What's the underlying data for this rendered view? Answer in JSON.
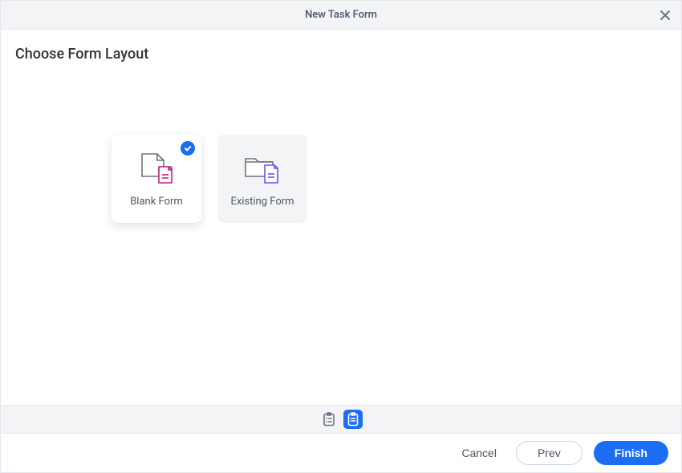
{
  "dialog": {
    "title": "New Task Form"
  },
  "section": {
    "title": "Choose Form Layout"
  },
  "options": {
    "blank": {
      "label": "Blank Form",
      "selected": true
    },
    "existing": {
      "label": "Existing Form",
      "selected": false
    }
  },
  "stepper": {
    "steps": [
      "form-details",
      "form-layout"
    ],
    "activeIndex": 1
  },
  "footer": {
    "cancel_label": "Cancel",
    "prev_label": "Prev",
    "finish_label": "Finish"
  },
  "colors": {
    "accent": "#1b6ef3",
    "blank_icon_accent": "#b92d82",
    "existing_icon_accent": "#6b4ef0",
    "neutral": "#6b7280"
  }
}
